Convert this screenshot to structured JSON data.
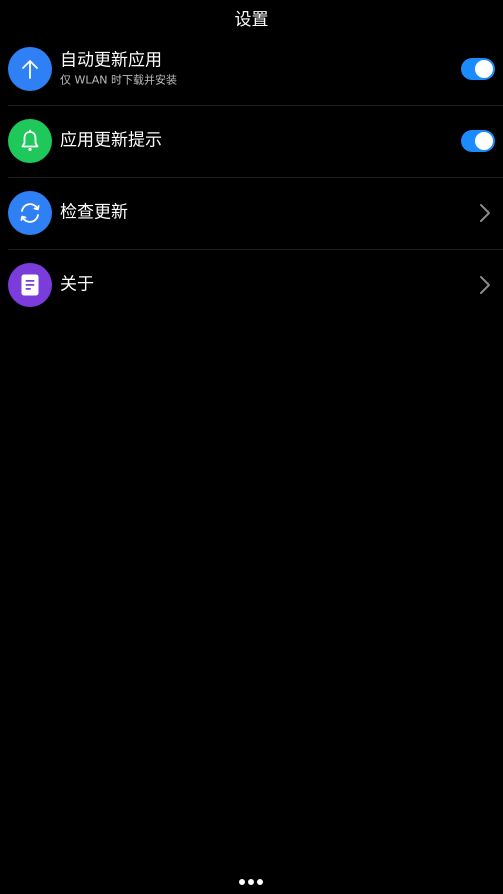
{
  "header": {
    "title": "设置"
  },
  "settings": {
    "items": [
      {
        "icon": "arrow-up-icon",
        "icon_color": "#2f80f5",
        "title": "自动更新应用",
        "subtitle": "仅 WLAN 时下载并安装",
        "control": "toggle",
        "toggle_on": true
      },
      {
        "icon": "bell-icon",
        "icon_color": "#1ec85a",
        "title": "应用更新提示",
        "control": "toggle",
        "toggle_on": true
      },
      {
        "icon": "refresh-icon",
        "icon_color": "#2f80f5",
        "title": "检查更新",
        "control": "chevron"
      },
      {
        "icon": "document-icon",
        "icon_color": "#7a3ddb",
        "title": "关于",
        "control": "chevron"
      }
    ]
  },
  "colors": {
    "background": "#000000",
    "toggle_on": "#1a8cff",
    "divider": "#1f1f1f",
    "chevron": "#8a8a8a"
  },
  "footer": {
    "more_icon": "more-dots-icon"
  }
}
